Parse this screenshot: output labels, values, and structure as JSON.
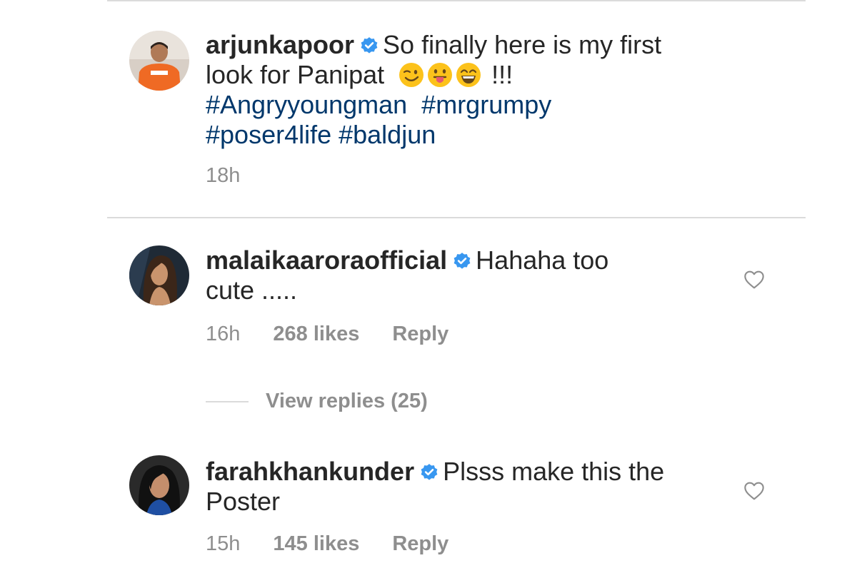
{
  "comments": [
    {
      "username": "arjunkapoor",
      "text_line1": "So finally here is my first",
      "text_line2": "look for Panipat",
      "emoji_names": [
        "winking-face",
        "face-with-tongue",
        "grinning-squinting-face"
      ],
      "exclaim": " !!!",
      "hashtags_line1": "#Angryyoungman  #mrgrumpy",
      "hashtags_line2": "#poser4life #baldjun",
      "time": "18h"
    },
    {
      "username": "malaikaaroraofficial",
      "text_line1": "Hahaha too",
      "text_line2": "cute .....",
      "time": "16h",
      "likes": "268 likes",
      "reply": "Reply",
      "view_replies": "View replies (25)"
    },
    {
      "username": "farahkhankunder",
      "text_line1": "Plsss make this the",
      "text_line2": "Poster",
      "time": "15h",
      "likes": "145 likes",
      "reply": "Reply"
    }
  ],
  "colors": {
    "text": "#262626",
    "meta": "#8e8e8e",
    "hashtag": "#00376b",
    "verified": "#3897f0",
    "divider": "#dbdbdb"
  },
  "icons": [
    "verified-badge-icon",
    "heart-outline-icon"
  ]
}
